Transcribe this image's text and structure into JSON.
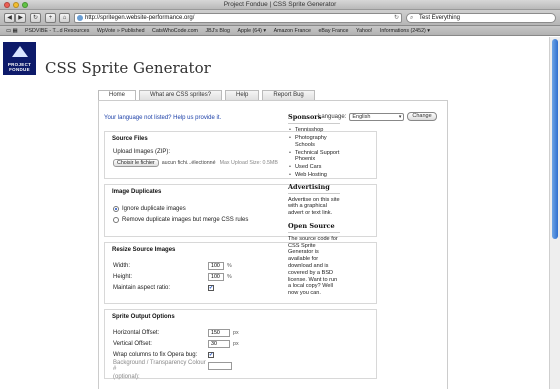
{
  "window": {
    "title": "Project Fondue | CSS Sprite Generator",
    "colors": {
      "close": "#ec5f55",
      "minimize": "#f2bd2f",
      "zoom": "#60c344"
    }
  },
  "toolbar": {
    "back_icon": "back-arrow-icon",
    "forward_icon": "forward-arrow-icon",
    "reload_icon": "reload-icon",
    "add_icon": "plus-icon",
    "home_icon": "home-icon",
    "url": "http://spritegen.website-performance.org/",
    "search_value": "Test Everything"
  },
  "bookmarks": [
    "PSDVIBE - T...d Resources",
    "WpVote » Published",
    "CatsWhoCode.com",
    "JBJ's Blog",
    "Apple (64) ▾",
    "Amazon France",
    "eBay France",
    "Yahoo!",
    "Informations (2452) ▾"
  ],
  "brand": {
    "logo_line1": "PROJECT",
    "logo_line2": "FONDUE",
    "site_title": "CSS Sprite Generator"
  },
  "tabs": [
    {
      "label": "Home"
    },
    {
      "label": "What are CSS sprites?"
    },
    {
      "label": "Help"
    },
    {
      "label": "Report Bug"
    }
  ],
  "language": {
    "not_listed": "Your language not listed? Help us provide it.",
    "label": "Language:",
    "value": "English",
    "change_button": "Change"
  },
  "sections": {
    "source": {
      "title": "Source Files",
      "upload_label": "Upload Images (ZIP):",
      "file_button": "Choisir le fichier",
      "file_status": "aucun fichi...électionné",
      "max_size": "Max Upload Size: 0.5MB"
    },
    "duplicates": {
      "title": "Image Duplicates",
      "option1": "Ignore duplicate images",
      "option2": "Remove duplicate images but merge CSS rules"
    },
    "resize": {
      "title": "Resize Source Images",
      "width_label": "Width:",
      "width_value": "100",
      "width_unit": "%",
      "height_label": "Height:",
      "height_value": "100",
      "height_unit": "%",
      "aspect_label": "Maintain aspect ratio:"
    },
    "sprite": {
      "title": "Sprite Output Options",
      "hoffset_label": "Horizontal Offset:",
      "hoffset_value": "150",
      "hoffset_unit": "px",
      "voffset_label": "Vertical Offset:",
      "voffset_value": "30",
      "voffset_unit": "px",
      "wrap_label": "Wrap columns to fix Opera bug:",
      "bg_label": "Background / Transparency Colour #",
      "bg_optional": "(optional):",
      "bg_value": ""
    }
  },
  "sidebar": {
    "sponsors_title": "Sponsors",
    "sponsors": [
      "Tennisshop",
      "Photography Schools",
      "Technical Support Phoenix",
      "Used Cars",
      "Web Hosting"
    ],
    "advertising_title": "Advertising",
    "advertising_text": "Advertise on this site with a graphical advert or text link.",
    "opensource_title": "Open Source",
    "opensource_text": "The source code for CSS Sprite Generator is available for download and is covered by a BSD license. Want to run a local copy? Well now you can."
  }
}
